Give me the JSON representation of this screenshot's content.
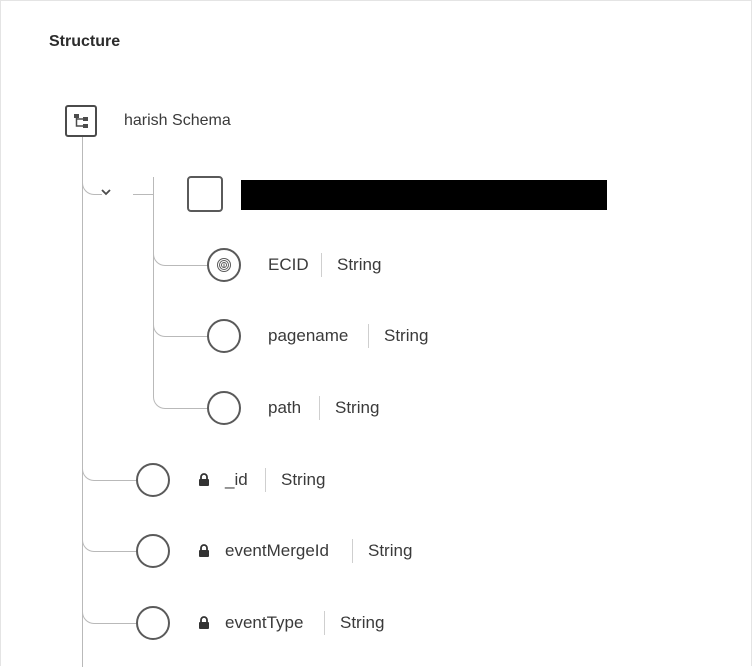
{
  "structure": {
    "title": "Structure",
    "root": {
      "label": "harish Schema",
      "icon": "schema-tree-icon"
    },
    "object_node": {
      "icon": "object-box-icon",
      "name_redacted": true,
      "expand_icon": "chevron-down-icon"
    },
    "nested_fields": [
      {
        "name": "ECID",
        "type": "String",
        "icon": "fingerprint-icon",
        "locked": false
      },
      {
        "name": "pagename",
        "type": "String",
        "icon": "field-circle-icon",
        "locked": false
      },
      {
        "name": "path",
        "type": "String",
        "icon": "field-circle-icon",
        "locked": false
      }
    ],
    "root_fields": [
      {
        "name": "_id",
        "type": "String",
        "icon": "field-circle-icon",
        "locked": true
      },
      {
        "name": "eventMergeId",
        "type": "String",
        "icon": "field-circle-icon",
        "locked": true
      },
      {
        "name": "eventType",
        "type": "String",
        "icon": "field-circle-icon",
        "locked": true
      }
    ]
  },
  "colors": {
    "line": "#b9b9b9",
    "text": "#3a3a3a",
    "redaction": "#000000"
  }
}
